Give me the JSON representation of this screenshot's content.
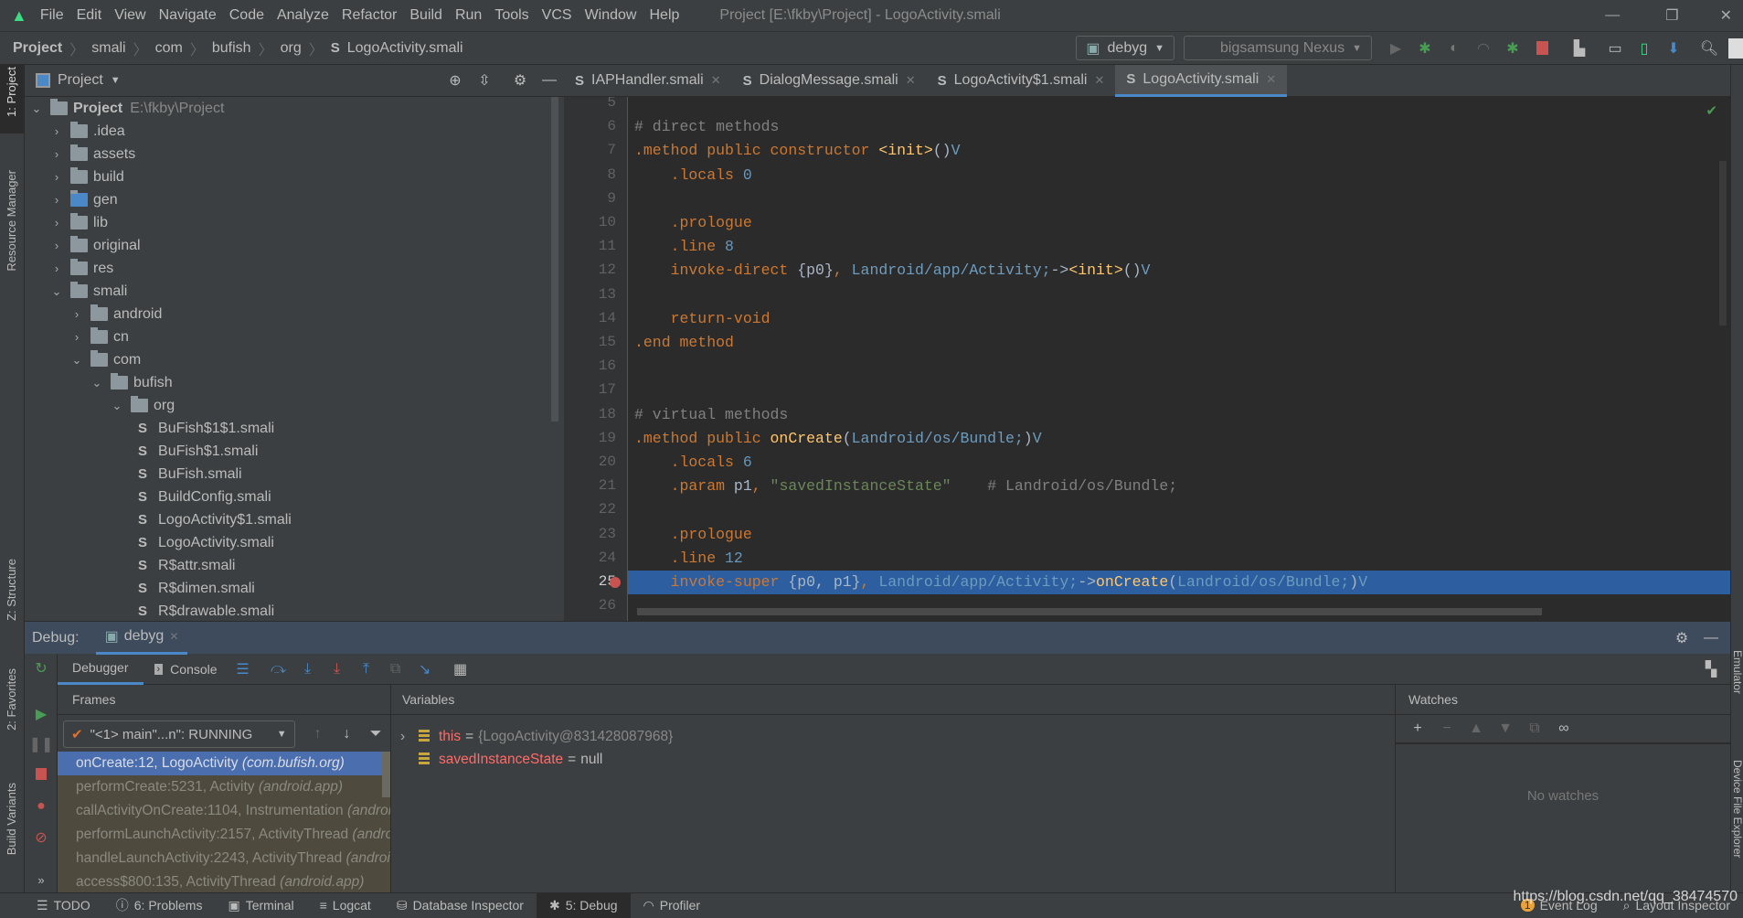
{
  "menubar": {
    "items": [
      "File",
      "Edit",
      "View",
      "Navigate",
      "Code",
      "Analyze",
      "Refactor",
      "Build",
      "Run",
      "Tools",
      "VCS",
      "Window",
      "Help"
    ],
    "window_title": "Project [E:\\fkby\\Project] - LogoActivity.smali"
  },
  "breadcrumb": [
    "Project",
    "smali",
    "com",
    "bufish",
    "org",
    "LogoActivity.smali"
  ],
  "toolbar": {
    "run_config": "debyg",
    "device": "bigsamsung Nexus"
  },
  "left_stripe": {
    "project": "1: Project",
    "resource_manager": "Resource Manager",
    "structure": "Z: Structure",
    "favorites": "2: Favorites",
    "build_variants": "Build Variants"
  },
  "right_stripe": {
    "emulator": "Emulator",
    "device_file_explorer": "Device File Explorer"
  },
  "project_panel": {
    "title": "Project",
    "root": {
      "label": "Project",
      "path": "E:\\fkby\\Project"
    },
    "tree": [
      {
        "label": ".idea",
        "depth": 1,
        "type": "folder",
        "state": "collapsed"
      },
      {
        "label": "assets",
        "depth": 1,
        "type": "folder",
        "state": "collapsed"
      },
      {
        "label": "build",
        "depth": 1,
        "type": "folder",
        "state": "collapsed"
      },
      {
        "label": "gen",
        "depth": 1,
        "type": "gen-folder",
        "state": "collapsed"
      },
      {
        "label": "lib",
        "depth": 1,
        "type": "folder",
        "state": "collapsed"
      },
      {
        "label": "original",
        "depth": 1,
        "type": "folder",
        "state": "collapsed"
      },
      {
        "label": "res",
        "depth": 1,
        "type": "folder",
        "state": "collapsed"
      },
      {
        "label": "smali",
        "depth": 1,
        "type": "folder",
        "state": "expanded"
      },
      {
        "label": "android",
        "depth": 2,
        "type": "folder",
        "state": "collapsed"
      },
      {
        "label": "cn",
        "depth": 2,
        "type": "folder",
        "state": "collapsed"
      },
      {
        "label": "com",
        "depth": 2,
        "type": "folder",
        "state": "expanded"
      },
      {
        "label": "bufish",
        "depth": 3,
        "type": "folder",
        "state": "expanded"
      },
      {
        "label": "org",
        "depth": 4,
        "type": "folder",
        "state": "expanded"
      },
      {
        "label": "BuFish$1$1.smali",
        "depth": 5,
        "type": "file"
      },
      {
        "label": "BuFish$1.smali",
        "depth": 5,
        "type": "file"
      },
      {
        "label": "BuFish.smali",
        "depth": 5,
        "type": "file"
      },
      {
        "label": "BuildConfig.smali",
        "depth": 5,
        "type": "file"
      },
      {
        "label": "LogoActivity$1.smali",
        "depth": 5,
        "type": "file"
      },
      {
        "label": "LogoActivity.smali",
        "depth": 5,
        "type": "file"
      },
      {
        "label": "R$attr.smali",
        "depth": 5,
        "type": "file"
      },
      {
        "label": "R$dimen.smali",
        "depth": 5,
        "type": "file"
      },
      {
        "label": "R$drawable.smali",
        "depth": 5,
        "type": "file"
      }
    ]
  },
  "editor_tabs": [
    {
      "label": "IAPHandler.smali",
      "active": false
    },
    {
      "label": "DialogMessage.smali",
      "active": false
    },
    {
      "label": "LogoActivity$1.smali",
      "active": false
    },
    {
      "label": "LogoActivity.smali",
      "active": true
    }
  ],
  "editor": {
    "current_line": 25,
    "breakpoint_line": 25,
    "lines": [
      {
        "n": 5,
        "tokens": []
      },
      {
        "n": 6,
        "tokens": [
          [
            "# direct methods",
            "c"
          ]
        ]
      },
      {
        "n": 7,
        "tokens": [
          [
            ".method public constructor ",
            "k"
          ],
          [
            "<init>",
            "f"
          ],
          [
            "()",
            "w"
          ],
          [
            "V",
            "t"
          ]
        ]
      },
      {
        "n": 8,
        "tokens": [
          [
            "    .locals ",
            "k"
          ],
          [
            "0",
            "n"
          ]
        ]
      },
      {
        "n": 9,
        "tokens": []
      },
      {
        "n": 10,
        "tokens": [
          [
            "    .prologue",
            "k"
          ]
        ]
      },
      {
        "n": 11,
        "tokens": [
          [
            "    .line ",
            "k"
          ],
          [
            "8",
            "n"
          ]
        ]
      },
      {
        "n": 12,
        "tokens": [
          [
            "    invoke-direct ",
            "k"
          ],
          [
            "{p0}",
            "w"
          ],
          [
            ", ",
            "k"
          ],
          [
            "Landroid/app/Activity;",
            "t"
          ],
          [
            "->",
            "w"
          ],
          [
            "<init>",
            "f"
          ],
          [
            "()",
            "w"
          ],
          [
            "V",
            "t"
          ]
        ]
      },
      {
        "n": 13,
        "tokens": []
      },
      {
        "n": 14,
        "tokens": [
          [
            "    return-void",
            "k"
          ]
        ]
      },
      {
        "n": 15,
        "tokens": [
          [
            ".end method",
            "k"
          ]
        ]
      },
      {
        "n": 16,
        "tokens": []
      },
      {
        "n": 17,
        "tokens": []
      },
      {
        "n": 18,
        "tokens": [
          [
            "# virtual methods",
            "c"
          ]
        ]
      },
      {
        "n": 19,
        "tokens": [
          [
            ".method public ",
            "k"
          ],
          [
            "onCreate",
            "f"
          ],
          [
            "(",
            "w"
          ],
          [
            "Landroid/os/Bundle;",
            "t"
          ],
          [
            ")",
            "w"
          ],
          [
            "V",
            "t"
          ]
        ]
      },
      {
        "n": 20,
        "tokens": [
          [
            "    .locals ",
            "k"
          ],
          [
            "6",
            "n"
          ]
        ]
      },
      {
        "n": 21,
        "tokens": [
          [
            "    .param ",
            "k"
          ],
          [
            "p1",
            "w"
          ],
          [
            ", ",
            "k"
          ],
          [
            "\"savedInstanceState\"",
            "s"
          ],
          [
            "    # Landroid/os/Bundle;",
            "c"
          ]
        ]
      },
      {
        "n": 22,
        "tokens": []
      },
      {
        "n": 23,
        "tokens": [
          [
            "    .prologue",
            "k"
          ]
        ]
      },
      {
        "n": 24,
        "tokens": [
          [
            "    .line ",
            "k"
          ],
          [
            "12",
            "n"
          ]
        ]
      },
      {
        "n": 25,
        "tokens": [
          [
            "    invoke-super ",
            "k"
          ],
          [
            "{p0, p1}",
            "w"
          ],
          [
            ", ",
            "k"
          ],
          [
            "Landroid/app/Activity;",
            "t"
          ],
          [
            "->",
            "w"
          ],
          [
            "onCreate",
            "f"
          ],
          [
            "(",
            "w"
          ],
          [
            "Landroid/os/Bundle;",
            "t"
          ],
          [
            ")",
            "w"
          ],
          [
            "V",
            "t"
          ]
        ]
      },
      {
        "n": 26,
        "tokens": []
      }
    ]
  },
  "debug": {
    "label": "Debug:",
    "session_tab": "debyg",
    "tabs": {
      "debugger": "Debugger",
      "console": "Console"
    },
    "frames": {
      "title": "Frames",
      "thread": "\"<1> main\"...n\": RUNNING",
      "items": [
        {
          "method": "onCreate:12, LogoActivity",
          "pkg": "(com.bufish.org)",
          "selected": true
        },
        {
          "method": "performCreate:5231, Activity",
          "pkg": "(android.app)"
        },
        {
          "method": "callActivityOnCreate:1104, Instrumentation",
          "pkg": "(android.app)"
        },
        {
          "method": "performLaunchActivity:2157, ActivityThread",
          "pkg": "(android.app)"
        },
        {
          "method": "handleLaunchActivity:2243, ActivityThread",
          "pkg": "(android.app)"
        },
        {
          "method": "access$800:135, ActivityThread",
          "pkg": "(android.app)"
        }
      ]
    },
    "variables": {
      "title": "Variables",
      "items": [
        {
          "name": "this",
          "value": "{LogoActivity@831428087968}",
          "expandable": true
        },
        {
          "name": "savedInstanceState",
          "value": "null",
          "expandable": false
        }
      ]
    },
    "watches": {
      "title": "Watches",
      "empty_text": "No watches"
    }
  },
  "statusbar": {
    "items": [
      "TODO",
      "6: Problems",
      "Terminal",
      "Logcat",
      "Database Inspector",
      "5: Debug",
      "Profiler"
    ],
    "active": "5: Debug",
    "right": {
      "event_log": "Event Log",
      "event_count": "1",
      "layout_inspector": "Layout Inspector"
    },
    "watermark": "https://blog.csdn.net/qq_38474570"
  },
  "colors": {
    "accent": "#4a88c7",
    "current_line": "#2d5e9f",
    "selected_frame": "#4b6eaf",
    "breakpoint": "#c75450",
    "keyword": "#cc7832",
    "function": "#ffc66d",
    "number": "#6897bb",
    "comment": "#808080",
    "string": "#6a8759"
  }
}
